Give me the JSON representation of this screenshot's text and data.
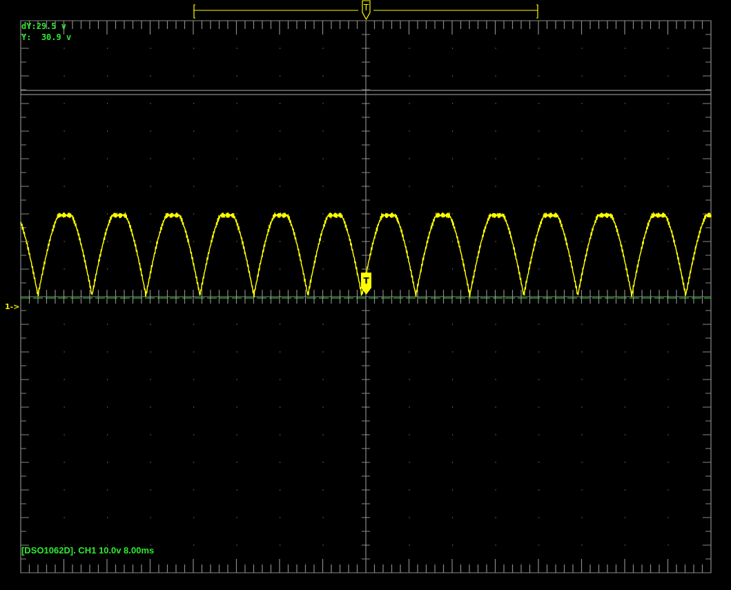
{
  "cursor_readout": [
    "dY:29.5 v",
    "Y:  30.9 v"
  ],
  "trigger_position": {
    "label": "T"
  },
  "channel_marker": "1->",
  "trigger_marker": {
    "label": "T"
  },
  "status_bar": "[DSO1062D]. CH1 10.0v 8.00ms"
}
